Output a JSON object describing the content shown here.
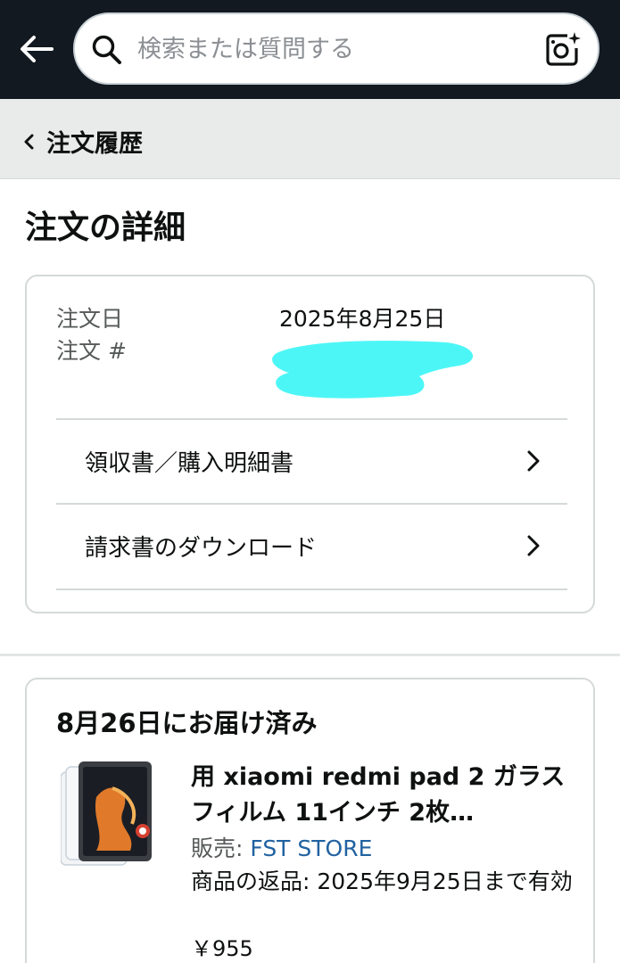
{
  "header": {
    "search_placeholder": "検索または質問する",
    "icons": [
      "back-arrow-icon",
      "search-icon",
      "camera-icon"
    ]
  },
  "breadcrumb": {
    "label": "注文履歴"
  },
  "page": {
    "title": "注文の詳細"
  },
  "order": {
    "date_label": "注文日",
    "date_value": "2025年8月25日",
    "number_label": "注文 #",
    "number_value_redacted": true
  },
  "links": [
    {
      "label": "領収書／購入明細書"
    },
    {
      "label": "請求書のダウンロード"
    }
  ],
  "shipment": {
    "status": "8月26日にお届け済み",
    "product": {
      "title": "用 xiaomi redmi pad 2 ガラスフィルム 11インチ 2枚…",
      "seller_label": "販売: ",
      "seller_name": "FST STORE",
      "return_text": "商品の返品: 2025年9月25日まで有効",
      "price": "￥955"
    }
  },
  "colors": {
    "topbar": "#131921",
    "crumb_bg": "#e9eaea",
    "link": "#2162a1",
    "redaction": "#4df6f6"
  }
}
